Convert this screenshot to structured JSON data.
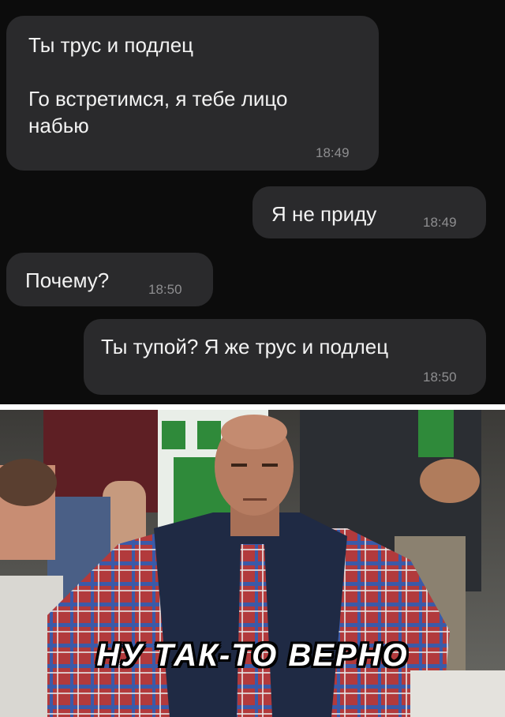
{
  "messages": [
    {
      "lines": [
        "Ты трус и подлец",
        "",
        "Го встретимся, я тебе лицо",
        "набью"
      ],
      "time": "18:49",
      "side": "incoming"
    },
    {
      "lines": [
        "Я не приду"
      ],
      "time": "18:49",
      "side": "outgoing"
    },
    {
      "lines": [
        "Почему?"
      ],
      "time": "18:50",
      "side": "incoming"
    },
    {
      "lines": [
        "Ты тупой? Я же трус и подлец"
      ],
      "time": "18:50",
      "side": "outgoing"
    }
  ],
  "meme": {
    "caption": "НУ ТАК-ТО ВЕРНО"
  },
  "colors": {
    "chat_bg": "#0c0c0c",
    "bubble": "#2a2a2c",
    "text": "#f2f2f2",
    "time": "#8e8e90"
  }
}
